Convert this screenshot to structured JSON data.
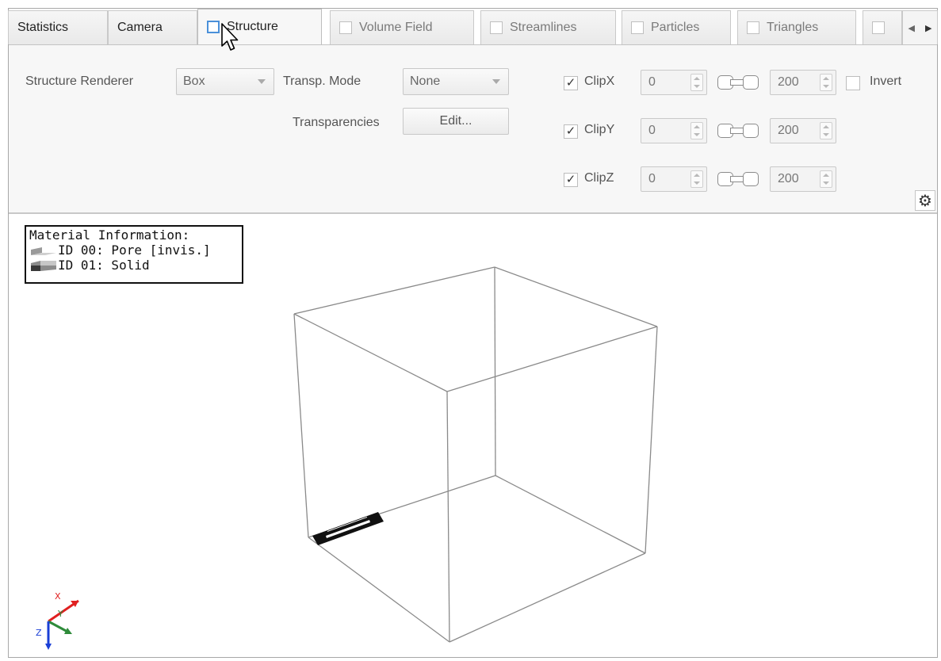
{
  "tabs": [
    {
      "label": "Statistics",
      "has_checkbox": false,
      "active": false
    },
    {
      "label": "Camera",
      "has_checkbox": false,
      "active": false
    },
    {
      "label": "Structure",
      "has_checkbox": true,
      "active": true
    },
    {
      "label": "Volume Field",
      "has_checkbox": true,
      "active": false
    },
    {
      "label": "Streamlines",
      "has_checkbox": true,
      "active": false
    },
    {
      "label": "Particles",
      "has_checkbox": true,
      "active": false
    },
    {
      "label": "Triangles",
      "has_checkbox": true,
      "active": false
    }
  ],
  "structure": {
    "renderer_label": "Structure Renderer",
    "renderer_value": "Box",
    "transp_mode_label": "Transp. Mode",
    "transp_mode_value": "None",
    "transparencies_label": "Transparencies",
    "edit_button": "Edit...",
    "invert_label": "Invert",
    "clips": [
      {
        "label": "ClipX",
        "checked": true,
        "min": "0",
        "max": "200"
      },
      {
        "label": "ClipY",
        "checked": true,
        "min": "0",
        "max": "200"
      },
      {
        "label": "ClipZ",
        "checked": true,
        "min": "0",
        "max": "200"
      }
    ]
  },
  "material_info": {
    "title": "Material Information:",
    "items": [
      {
        "label": "ID 00: Pore [invis.]"
      },
      {
        "label": "ID 01: Solid"
      }
    ]
  },
  "axis_labels": {
    "x": "X",
    "y": "Y",
    "z": "Z"
  },
  "colors": {
    "accent": "#4a90d9",
    "axis_x": "#e02020",
    "axis_y": "#2e8b3a",
    "axis_z": "#1a3fd6"
  }
}
